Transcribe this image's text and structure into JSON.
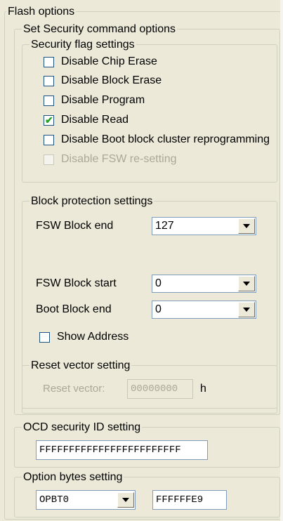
{
  "flash_options": {
    "title": "Flash options",
    "set_security": {
      "title": "Set Security command options",
      "security_flags": {
        "title": "Security flag settings",
        "items": [
          {
            "label": "Disable Chip Erase",
            "checked": false,
            "enabled": true
          },
          {
            "label": "Disable Block Erase",
            "checked": false,
            "enabled": true
          },
          {
            "label": "Disable Program",
            "checked": false,
            "enabled": true
          },
          {
            "label": "Disable Read",
            "checked": true,
            "enabled": true
          },
          {
            "label": "Disable Boot block cluster reprogramming",
            "checked": false,
            "enabled": true
          },
          {
            "label": "Disable FSW re-setting",
            "checked": false,
            "enabled": false
          }
        ]
      },
      "block_protection": {
        "title": "Block protection settings",
        "fsw_block_end_label": "FSW Block end",
        "fsw_block_end_value": "127",
        "fsw_block_start_label": "FSW Block start",
        "fsw_block_start_value": "0",
        "boot_block_end_label": "Boot Block end",
        "boot_block_end_value": "0",
        "show_address_label": "Show Address",
        "show_address_checked": false,
        "reset_vector": {
          "title": "Reset vector setting",
          "label": "Reset vector:",
          "value": "00000000",
          "unit": "h"
        }
      }
    },
    "ocd_security": {
      "title": "OCD security ID setting",
      "value": "FFFFFFFFFFFFFFFFFFFFFFFF"
    },
    "option_bytes": {
      "title": "Option bytes setting",
      "selected": "OPBT0",
      "value": "FFFFFFE9"
    }
  },
  "colors": {
    "background": "#ECE9D8",
    "check_mark": "#21A121",
    "disabled_text": "#ACA899",
    "input_border": "#7F9DB9"
  }
}
